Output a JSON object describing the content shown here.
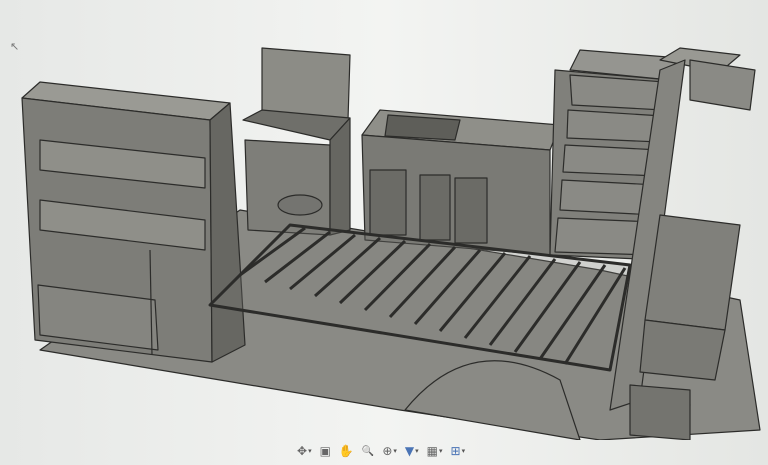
{
  "viewport": {
    "background": "#eef0ee",
    "model_color": "#7b7b76",
    "edge_color": "#2c2c2a"
  },
  "navbar": {
    "items": [
      {
        "icon": "orbit-icon",
        "glyph": "✥",
        "dropdown": true
      },
      {
        "icon": "look-at-icon",
        "glyph": "▣",
        "dropdown": false
      },
      {
        "icon": "pan-icon",
        "glyph": "✋",
        "dropdown": false
      },
      {
        "icon": "zoom-icon",
        "glyph": "🔍",
        "dropdown": false
      },
      {
        "icon": "fit-icon",
        "glyph": "⊕",
        "dropdown": true
      },
      {
        "icon": "display-settings-icon",
        "glyph": "▼",
        "dropdown": true
      },
      {
        "icon": "grid-settings-icon",
        "glyph": "▦",
        "dropdown": true
      },
      {
        "icon": "viewports-icon",
        "glyph": "⊞",
        "dropdown": true
      }
    ]
  }
}
